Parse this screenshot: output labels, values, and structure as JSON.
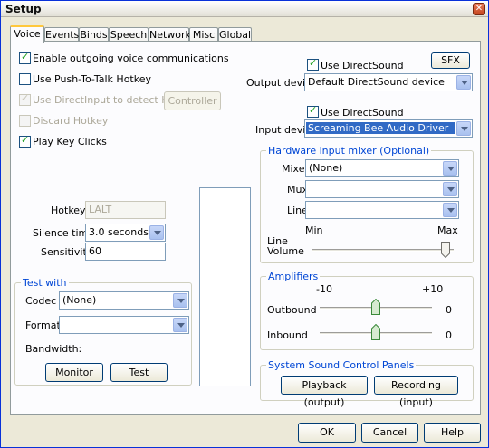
{
  "window": {
    "title": "Setup",
    "close_glyph": "✕"
  },
  "tabs": [
    {
      "label": "Voice",
      "active": true
    },
    {
      "label": "Events"
    },
    {
      "label": "Binds"
    },
    {
      "label": "Speech"
    },
    {
      "label": "Network"
    },
    {
      "label": "Misc"
    },
    {
      "label": "Global"
    }
  ],
  "left": {
    "enable_outgoing": {
      "label": "Enable outgoing voice communications",
      "checked": true
    },
    "push_to_talk": {
      "label": "Use Push-To-Talk Hotkey",
      "checked": false
    },
    "directinput": {
      "label": "Use DirectInput to detect Hotkey",
      "checked": true,
      "disabled": true
    },
    "controller_button": "Controller",
    "discard_hotkey": {
      "label": "Discard Hotkey",
      "checked": false,
      "disabled": true
    },
    "play_key_clicks": {
      "label": "Play Key Clicks",
      "checked": true
    },
    "hotkey_label": "Hotkey",
    "hotkey_value": "LALT",
    "silence_label": "Silence time",
    "silence_value": "3.0 seconds",
    "sensitivity_label": "Sensitivity",
    "sensitivity_value": "60"
  },
  "test_with": {
    "title": "Test with",
    "codec_label": "Codec",
    "codec_value": "(None)",
    "format_label": "Format",
    "format_value": "",
    "bandwidth_label": "Bandwidth:",
    "monitor_button": "Monitor",
    "test_button": "Test"
  },
  "output": {
    "use_directsound": {
      "label": "Use DirectSound",
      "checked": true
    },
    "sfx_button": "SFX",
    "device_label": "Output device",
    "device_value": "Default DirectSound device"
  },
  "input": {
    "use_directsound": {
      "label": "Use DirectSound",
      "checked": true
    },
    "device_label": "Input device",
    "device_value": "Screaming Bee Audio Driver"
  },
  "mixer": {
    "title": "Hardware input mixer (Optional)",
    "mixer_label": "Mixer",
    "mixer_value": "(None)",
    "mux_label": "Mux",
    "mux_value": "",
    "line_label": "Line",
    "line_value": "",
    "min_label": "Min",
    "max_label": "Max",
    "line_volume_label_1": "Line",
    "line_volume_label_2": "Volume",
    "line_volume_level": 1.0
  },
  "amplifiers": {
    "title": "Amplifiers",
    "scale_min": "-10",
    "scale_max": "+10",
    "outbound_label": "Outbound",
    "outbound_value": "0",
    "inbound_label": "Inbound",
    "inbound_value": "0"
  },
  "sound_panels": {
    "title": "System Sound Control Panels",
    "playback_button": "Playback (output)",
    "recording_button": "Recording (input)"
  },
  "footer": {
    "ok": "OK",
    "cancel": "Cancel",
    "help": "Help"
  },
  "colors": {
    "group_title": "#0046d5",
    "check": "#21a121",
    "tab_highlight": "#ffc83c"
  }
}
